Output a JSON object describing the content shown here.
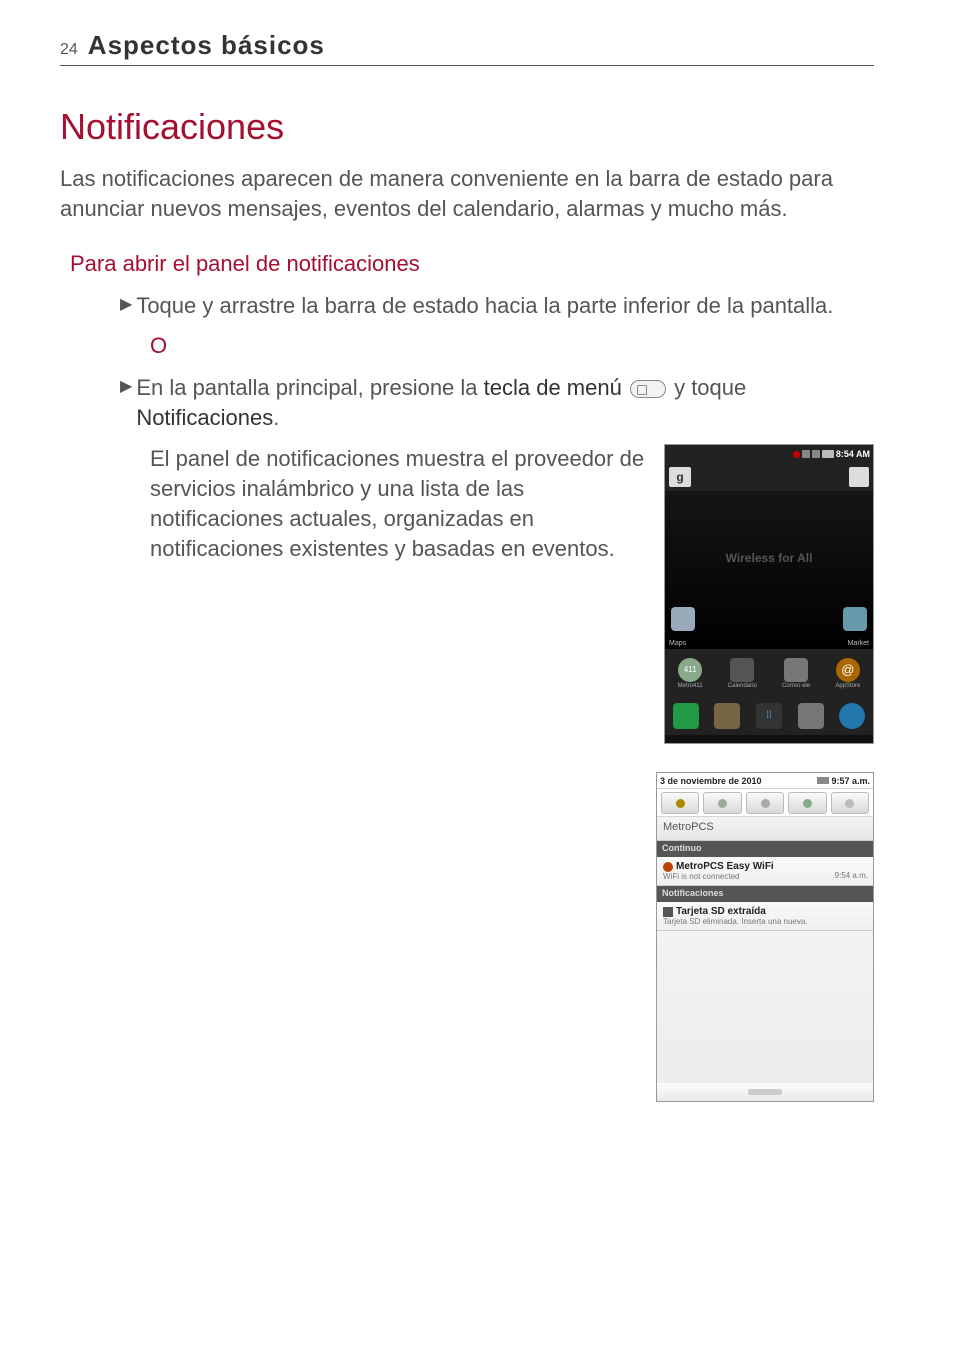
{
  "header": {
    "page_number": "24",
    "chapter_title": "Aspectos básicos"
  },
  "title": "Notificaciones",
  "intro": "Las notificaciones aparecen de manera conveniente en la barra de estado para anunciar nuevos mensajes, eventos del calendario, alarmas y mucho más.",
  "subtitle": "Para abrir el panel de notificaciones",
  "bullet1": "Toque y arrastre la barra de estado hacia la parte inferior de la pantalla.",
  "or_label": "O",
  "bullet2_pre": "En la pantalla principal, presione la ",
  "bullet2_bold1": "tecla de menú",
  "bullet2_mid": " y toque ",
  "bullet2_bold2": "Notificaciones",
  "bullet2_post": ".",
  "panel_para": "El panel de notificaciones muestra el proveedor de servicios inalámbrico y una lista de las notificaciones actuales, organizadas en notificaciones existentes y basadas en eventos.",
  "phone1": {
    "status_time": "8:54 AM",
    "quick_left": "g",
    "wall_text": "Wireless for All",
    "apps_top": [
      {
        "label": "Maps"
      },
      {
        "label": "Market"
      }
    ],
    "dock_apps": [
      {
        "label": "Metro411"
      },
      {
        "label": "Calendario"
      },
      {
        "label": "Correo ele"
      },
      {
        "label": "AppStore"
      }
    ]
  },
  "phone2": {
    "date": "3 de noviembre de 2010",
    "time": "9:57 a.m.",
    "carrier": "MetroPCS",
    "section1": "Continuo",
    "item1_title": "MetroPCS Easy WiFi",
    "item1_sub": "WiFi is not connected",
    "item1_time": "9:54 a.m.",
    "section2": "Notificaciones",
    "item2_title": "Tarjeta SD extraída",
    "item2_sub": "Tarjeta SD eliminada. Inserta una nueva."
  }
}
